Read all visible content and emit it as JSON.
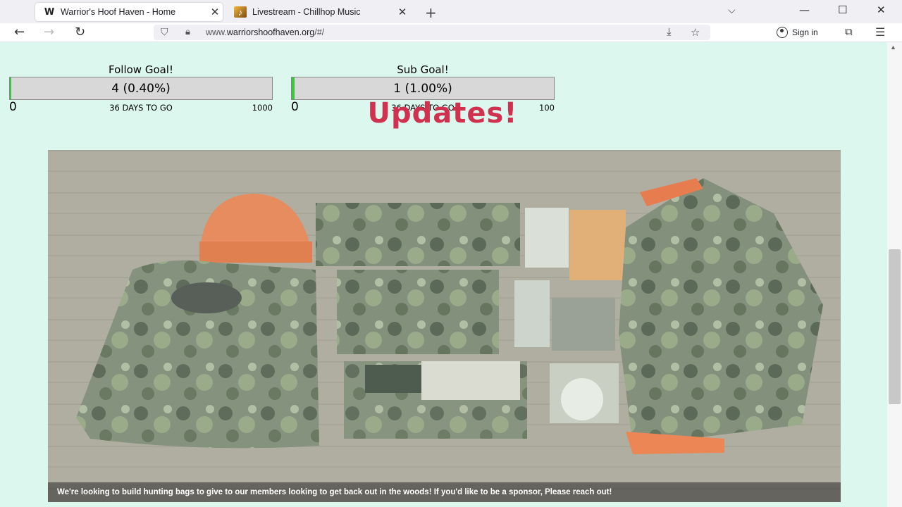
{
  "browser": {
    "tabs": [
      {
        "label": "Warrior's Hoof Haven - Home",
        "favicon": "w-logo-icon",
        "active": true
      },
      {
        "label": "Livestream - Chillhop Music",
        "favicon": "chillhop-icon",
        "active": false
      }
    ],
    "url": {
      "prefix": "www.",
      "domain": "warriorshoofhaven.org",
      "path": "/#/"
    },
    "signin_label": "Sign in"
  },
  "goals": [
    {
      "title": "Follow Goal!",
      "value_text": "4 (0.40%)",
      "progress": 0.004,
      "min": "0",
      "days": "36 DAYS TO GO",
      "max": "1000"
    },
    {
      "title": "Sub Goal!",
      "value_text": "1 (1.00%)",
      "progress": 0.01,
      "min": "0",
      "days": "36 DAYS TO GO",
      "max": "100"
    }
  ],
  "updates_heading": "Updates!",
  "slideshow": {
    "image": "hunting-gear-flatlay",
    "caption": "We're looking to build hunting bags to give to our members looking to get back out in the woods! If you'd like to be a sponsor, Please reach out!"
  },
  "colors": {
    "page_bg": "#dcf7ee",
    "heading": "#d0314f",
    "progress_fill": "#3ec43e"
  }
}
